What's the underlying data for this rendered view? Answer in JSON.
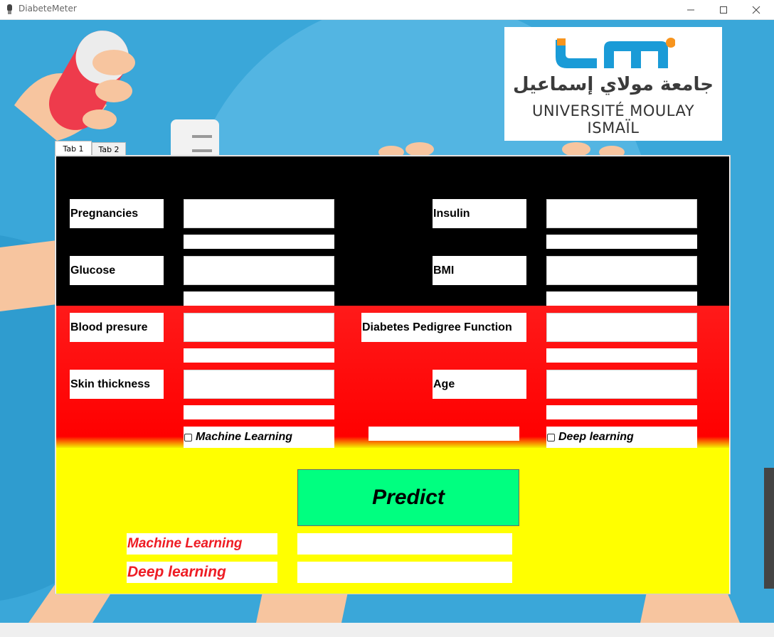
{
  "window": {
    "title": "DiabeteMeter",
    "icon": "app-icon",
    "buttons": [
      "minimize-icon",
      "maximize-icon",
      "close-icon"
    ]
  },
  "logo": {
    "latin_text": "UNIVERSITÉ MOULAY ISMAÏL",
    "arabic_text": "جامعة مولاي إسماعيل",
    "colors": {
      "blue": "#1a9bd7",
      "orange": "#f7941d"
    }
  },
  "tabs": [
    {
      "label": "Tab 1",
      "selected": true
    },
    {
      "label": "Tab 2",
      "selected": false
    }
  ],
  "form": {
    "pregnancies_label": "Pregnancies",
    "glucose_label": "Glucose",
    "blood_pressure_label": "Blood presure",
    "skin_thickness_label": "Skin thickness",
    "insulin_label": "Insulin",
    "bmi_label": "BMI",
    "dpf_label": "Diabetes Pedigree Function",
    "age_label": "Age",
    "ml_checkbox_label": "Machine Learning",
    "dl_checkbox_label": "Deep learning",
    "values": {
      "pregnancies": "",
      "glucose": "",
      "blood_pressure": "",
      "skin_thickness": "",
      "insulin": "",
      "bmi": "",
      "dpf": "",
      "age": ""
    }
  },
  "predict_label": "Predict",
  "results": {
    "ml_label": "Machine Learning",
    "dl_label": "Deep learning",
    "ml_value": "",
    "dl_value": ""
  },
  "colors": {
    "band_black": "#000000",
    "band_red": "#ff0000",
    "band_yellow": "#ffff00",
    "predict_button": "#00ff80",
    "result_label_text": "#ee1c24",
    "background": "#3aa7d9"
  }
}
